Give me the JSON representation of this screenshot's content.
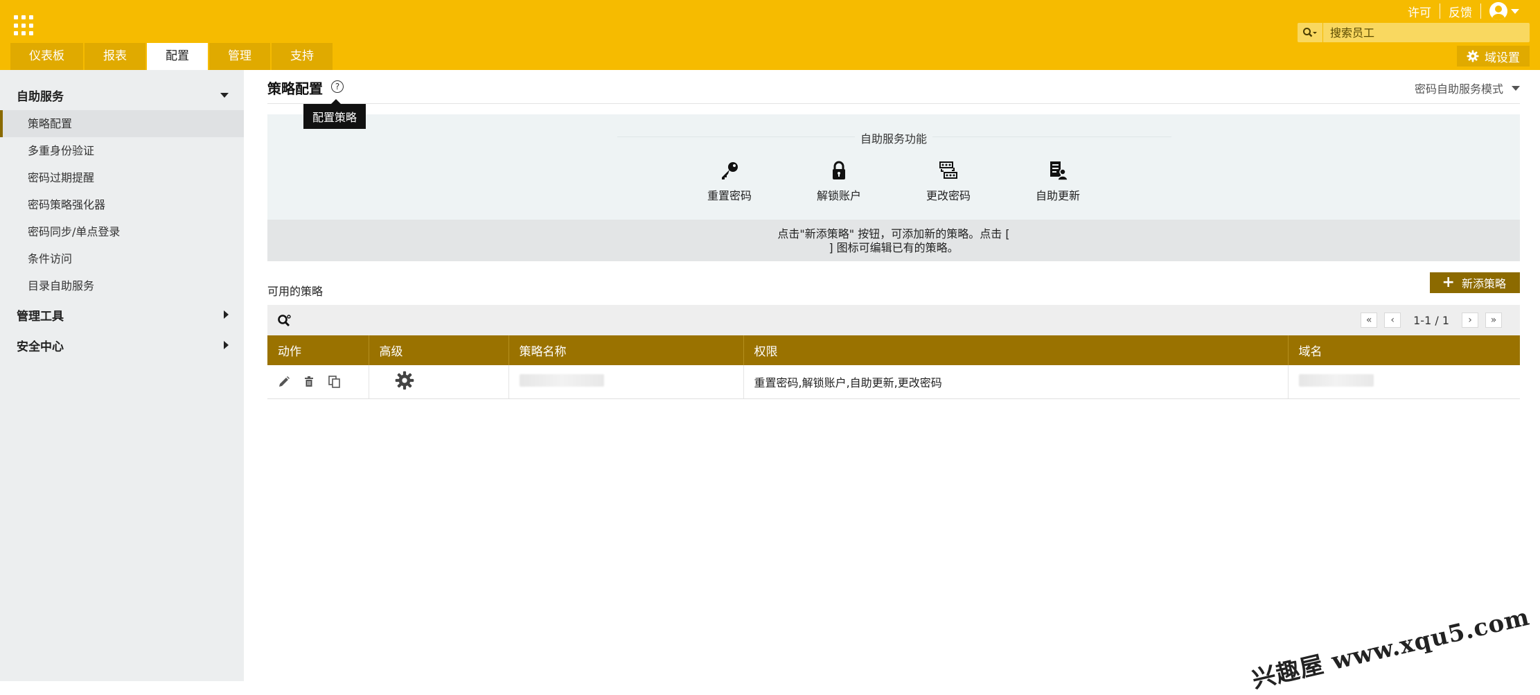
{
  "header": {
    "links": [
      "许可",
      "反馈"
    ],
    "search_placeholder": "搜索员工",
    "tabs": [
      {
        "label": "仪表板",
        "active": false
      },
      {
        "label": "报表",
        "active": false
      },
      {
        "label": "配置",
        "active": true
      },
      {
        "label": "管理",
        "active": false
      },
      {
        "label": "支持",
        "active": false
      }
    ],
    "domain_settings_label": "域设置"
  },
  "sidebar": {
    "groups": [
      {
        "label": "自助服务",
        "expanded": true,
        "items": [
          {
            "label": "策略配置",
            "active": true
          },
          {
            "label": "多重身份验证",
            "active": false
          },
          {
            "label": "密码过期提醒",
            "active": false
          },
          {
            "label": "密码策略强化器",
            "active": false
          },
          {
            "label": "密码同步/单点登录",
            "active": false
          },
          {
            "label": "条件访问",
            "active": false
          },
          {
            "label": "目录自助服务",
            "active": false
          }
        ]
      },
      {
        "label": "管理工具",
        "expanded": false
      },
      {
        "label": "安全中心",
        "expanded": false
      }
    ]
  },
  "main": {
    "title": "策略配置",
    "help_glyph": "?",
    "tooltip": "配置策略",
    "mode_selector": "密码自助服务模式",
    "features_title": "自助服务功能",
    "features": [
      {
        "label": "重置密码",
        "icon": "key-icon"
      },
      {
        "label": "解锁账户",
        "icon": "lock-icon"
      },
      {
        "label": "更改密码",
        "icon": "change-password-icon"
      },
      {
        "label": "自助更新",
        "icon": "self-update-icon"
      }
    ],
    "hint_line1": "点击\"新添策略\" 按钮，可添加新的策略。点击 [",
    "hint_line2": "] 图标可编辑已有的策略。",
    "available_title": "可用的策略",
    "new_policy_label": "新添策略",
    "pagination": "1-1 / 1",
    "table": {
      "columns": [
        "动作",
        "高级",
        "策略名称",
        "权限",
        "域名"
      ],
      "rows": [
        {
          "permissions": "重置密码,解锁账户,自助更新,更改密码"
        }
      ]
    }
  },
  "watermark": "兴趣屋 www.xqu5.com",
  "colors": {
    "brand": "#f6bb00",
    "table_header": "#9a7200",
    "button": "#8c6a00"
  }
}
